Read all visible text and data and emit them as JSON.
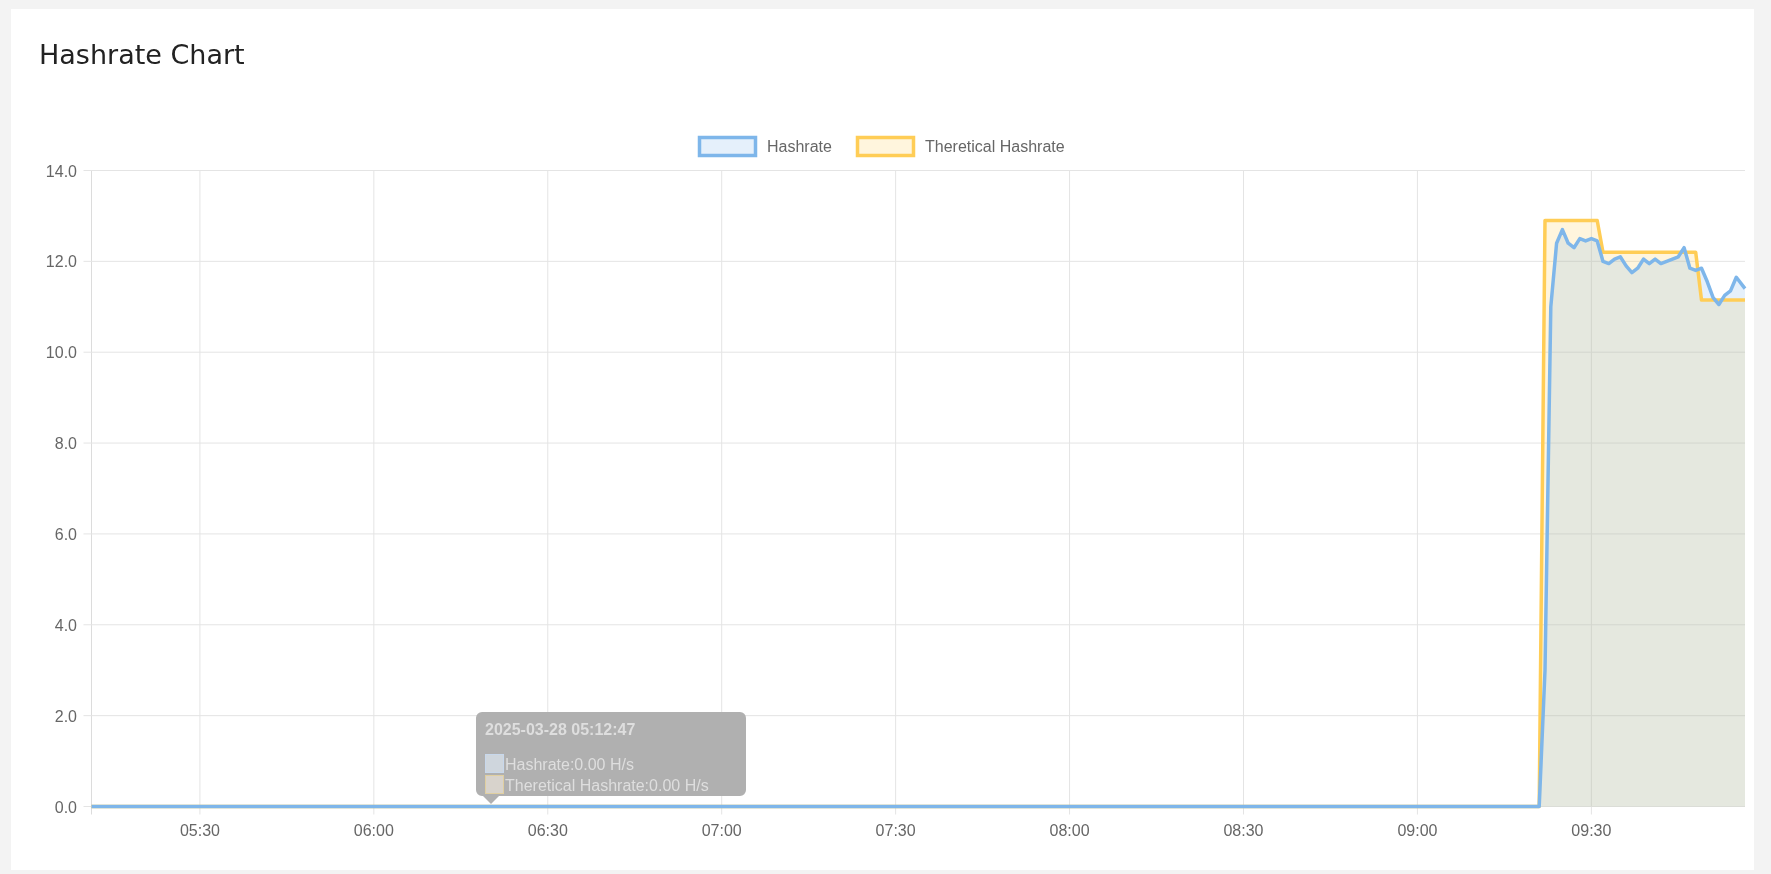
{
  "card": {
    "title": "Hashrate Chart"
  },
  "chart_data": {
    "type": "area",
    "grid": true,
    "legend": "top",
    "x": [
      311.3,
      561,
      562,
      563,
      564,
      565,
      566,
      567,
      568,
      569,
      570,
      571,
      572,
      573,
      574,
      575,
      576,
      577,
      578,
      579,
      580,
      581,
      582,
      583,
      584,
      585,
      586,
      587,
      588,
      589,
      590,
      591,
      592,
      593,
      594,
      595,
      596.5
    ],
    "series": [
      {
        "name": "Hashrate",
        "color": "#7eb6ea",
        "values": [
          0,
          0,
          3,
          11,
          12.4,
          12.7,
          12.4,
          12.3,
          12.5,
          12.45,
          12.5,
          12.45,
          12.0,
          11.95,
          12.05,
          12.1,
          11.9,
          11.75,
          11.85,
          12.05,
          11.95,
          12.05,
          11.95,
          12.0,
          12.05,
          12.1,
          12.3,
          11.85,
          11.8,
          11.85,
          11.55,
          11.2,
          11.05,
          11.25,
          11.35,
          11.65,
          11.4
        ]
      },
      {
        "name": "Theretical Hashrate",
        "color": "#ffcd56",
        "values": [
          0,
          0,
          12.9,
          12.9,
          12.9,
          12.9,
          12.9,
          12.9,
          12.9,
          12.9,
          12.9,
          12.9,
          12.2,
          12.2,
          12.2,
          12.2,
          12.2,
          12.2,
          12.2,
          12.2,
          12.2,
          12.2,
          12.2,
          12.2,
          12.2,
          12.2,
          12.2,
          12.2,
          12.2,
          11.15,
          11.15,
          11.15,
          11.15,
          11.15,
          11.15,
          11.15,
          11.15
        ]
      }
    ],
    "xlim": [
      311.3,
      596.5
    ],
    "ylim": [
      0,
      14
    ],
    "xticks": [
      {
        "value": 330,
        "label": "05:30"
      },
      {
        "value": 360,
        "label": "06:00"
      },
      {
        "value": 390,
        "label": "06:30"
      },
      {
        "value": 420,
        "label": "07:00"
      },
      {
        "value": 450,
        "label": "07:30"
      },
      {
        "value": 480,
        "label": "08:00"
      },
      {
        "value": 510,
        "label": "08:30"
      },
      {
        "value": 540,
        "label": "09:00"
      },
      {
        "value": 570,
        "label": "09:30"
      }
    ],
    "yticks": [
      {
        "value": 0,
        "label": "0.0"
      },
      {
        "value": 2,
        "label": "2.0"
      },
      {
        "value": 4,
        "label": "4.0"
      },
      {
        "value": 6,
        "label": "6.0"
      },
      {
        "value": 8,
        "label": "8.0"
      },
      {
        "value": 10,
        "label": "10.0"
      },
      {
        "value": 12,
        "label": "12.0"
      },
      {
        "value": 14,
        "label": "14.0"
      }
    ]
  },
  "tooltip": {
    "title": "2025-03-28 05:12:47",
    "items": [
      {
        "label": "Hashrate:0.00 H/s",
        "color": "#cfd6dd"
      },
      {
        "label": "Theretical Hashrate:0.00 H/s",
        "color": "#d8d3cc"
      }
    ]
  }
}
